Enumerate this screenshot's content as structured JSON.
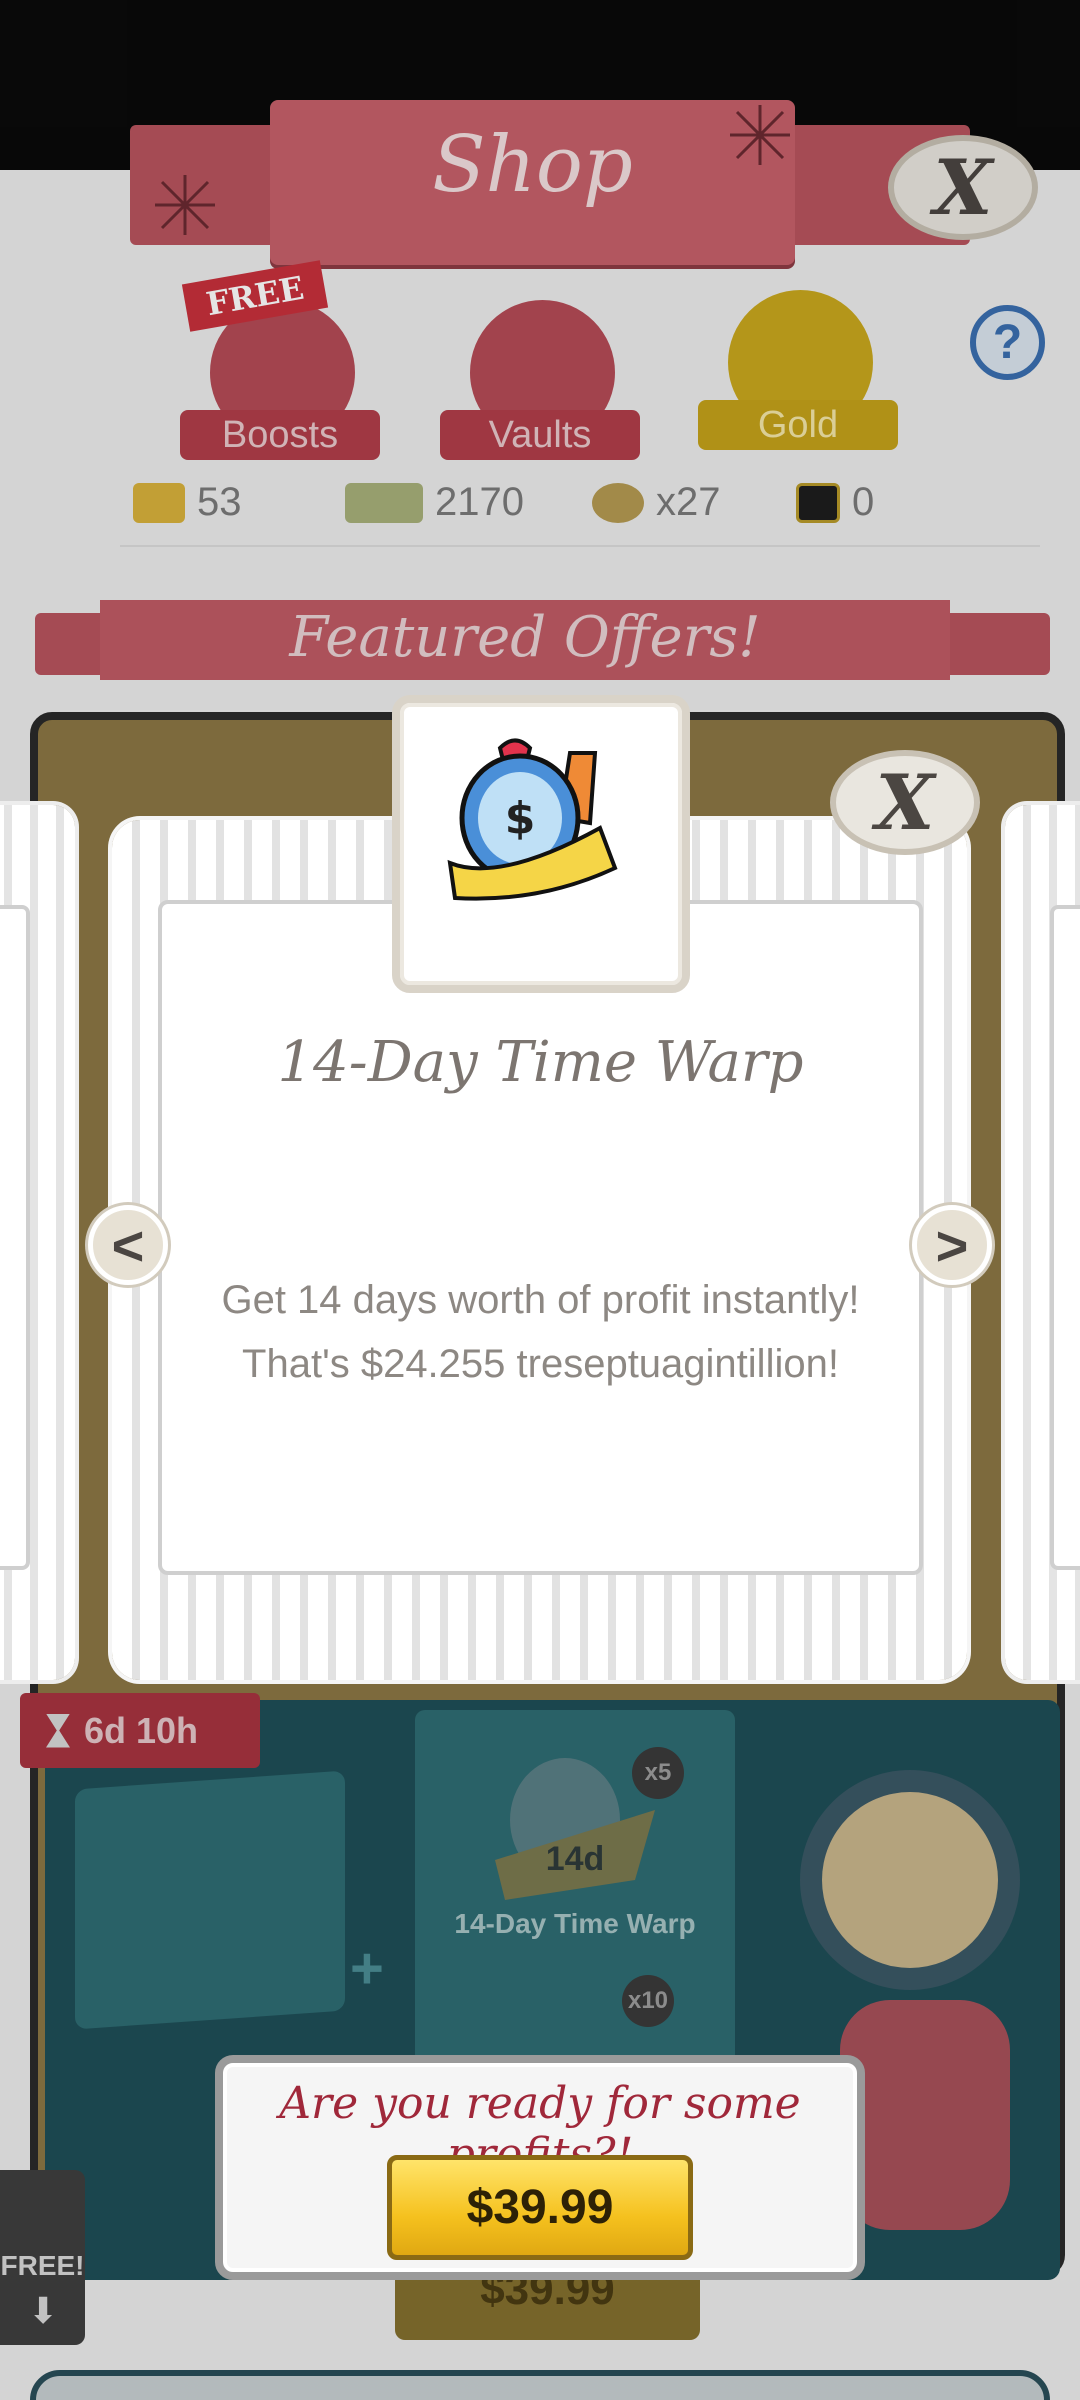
{
  "shop": {
    "title": "Shop",
    "close_symbol": "X",
    "help_symbol": "?",
    "tabs": [
      {
        "label": "Boosts",
        "badge": "FREE",
        "icon": "boost-icon"
      },
      {
        "label": "Vaults",
        "icon": "vault-icon"
      },
      {
        "label": "Gold",
        "icon": "gold-icon"
      }
    ],
    "currencies": [
      {
        "icon": "gold-bar-icon",
        "value": "53"
      },
      {
        "icon": "megabucks-icon",
        "value": "2170"
      },
      {
        "icon": "money-bag-icon",
        "value": "x27"
      },
      {
        "icon": "mega-ticket-icon",
        "value": "0"
      }
    ],
    "featured_title": "Featured Offers!",
    "offer": {
      "timer": "6d 10h",
      "bundle_item_label": "14-Day Time Warp",
      "bundle_item_days": "14d",
      "qty_1": "x5",
      "qty_2": "x10",
      "price_behind": "$39.99",
      "side_free": "FREE!",
      "side_arrow": "⬇"
    }
  },
  "modal": {
    "title": "14-Day Time Warp",
    "description_line1": "Get 14 days worth of profit instantly!",
    "description_line2": "That's $24.255 treseptuagintillion!",
    "close_symbol": "X",
    "prev_symbol": "<",
    "next_symbol": ">"
  },
  "prompt": {
    "text": "Are you ready for some profits?!",
    "price": "$39.99"
  },
  "colors": {
    "accent_red": "#c7606a",
    "price_gold": "#f5c11e",
    "prompt_text": "#a0283a"
  }
}
